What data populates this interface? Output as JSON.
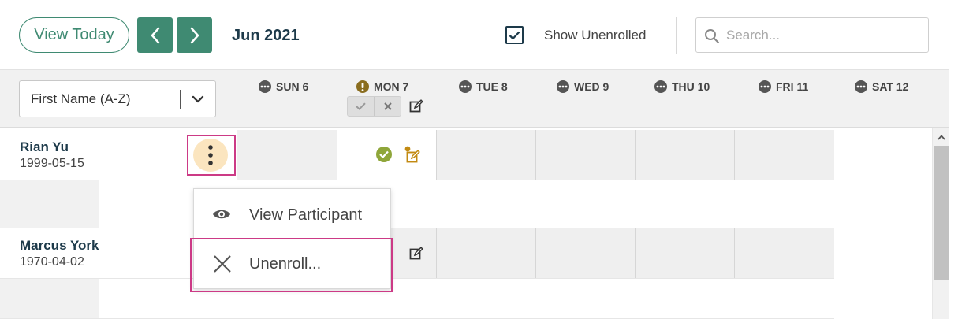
{
  "toolbar": {
    "view_today_label": "View Today",
    "month_label": "Jun 2021",
    "show_unenrolled_label": "Show Unenrolled",
    "show_unenrolled_checked": true,
    "search_placeholder": "Search..."
  },
  "header": {
    "sort_label": "First Name (A-Z)",
    "days": [
      {
        "label": "SUN 6",
        "status": "more"
      },
      {
        "label": "MON 7",
        "status": "warning"
      },
      {
        "label": "TUE 8",
        "status": "more"
      },
      {
        "label": "WED 9",
        "status": "more"
      },
      {
        "label": "THU 10",
        "status": "more"
      },
      {
        "label": "FRI 11",
        "status": "more"
      },
      {
        "label": "SAT 12",
        "status": "more"
      }
    ]
  },
  "participants": [
    {
      "name": "Rian Yu",
      "dob": "1999-05-15"
    },
    {
      "name": "Marcus York",
      "dob": "1970-04-02"
    }
  ],
  "context_menu": {
    "items": [
      {
        "label": "View Participant",
        "icon": "eye-icon"
      },
      {
        "label": "Unenroll...",
        "icon": "close-icon"
      }
    ]
  },
  "colors": {
    "primary": "#3f8a72",
    "navy": "#1d3a4a",
    "highlight": "#cc3a86",
    "success": "#8fa63a",
    "note": "#c28a12"
  }
}
